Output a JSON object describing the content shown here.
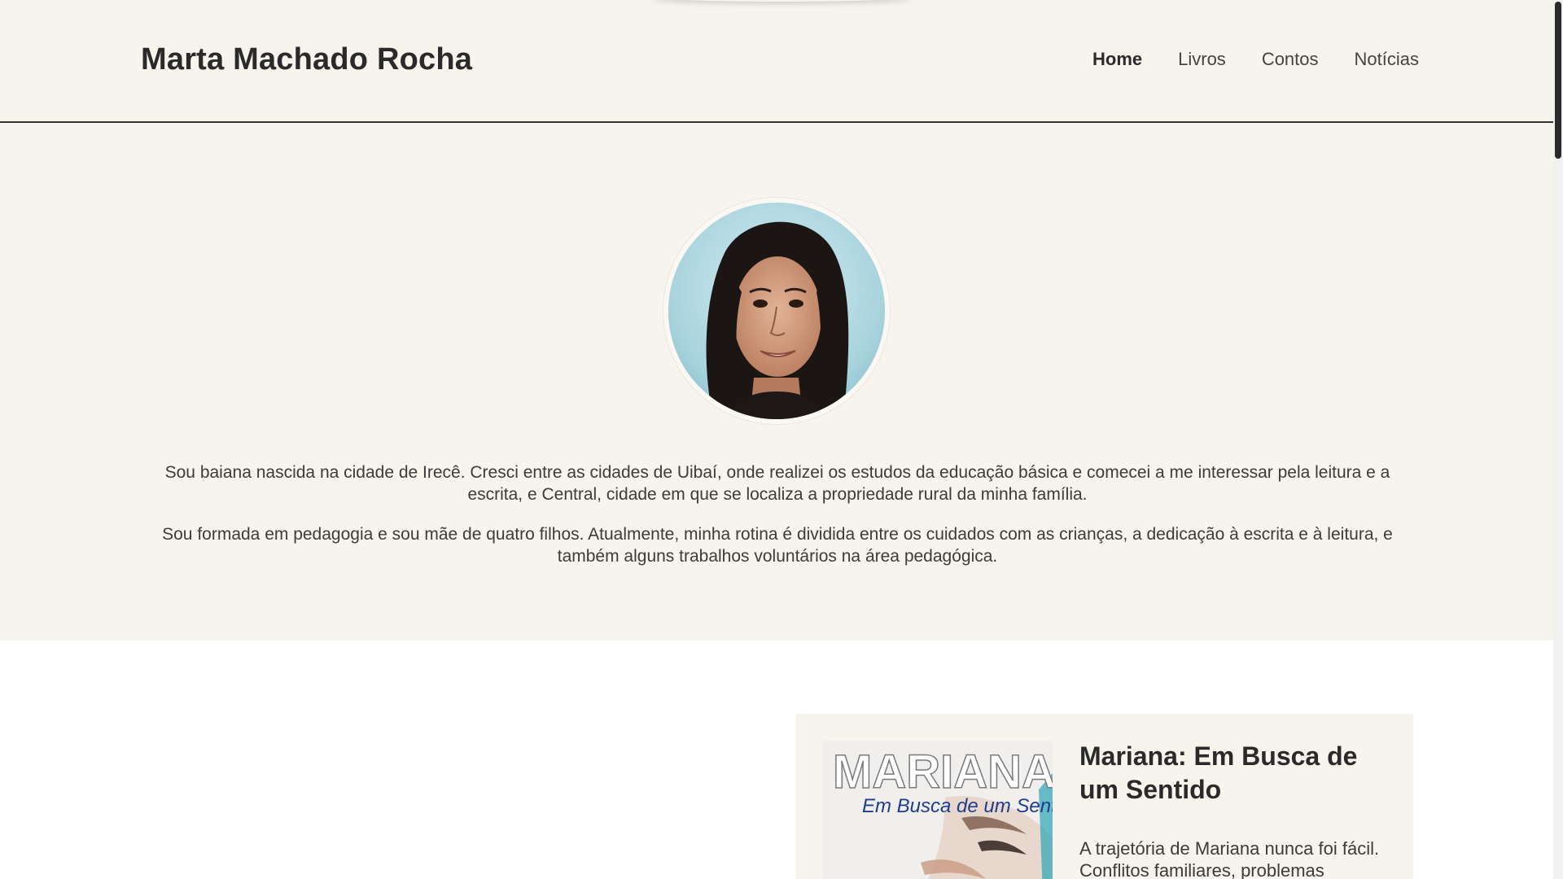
{
  "header": {
    "site_title": "Marta Machado Rocha",
    "nav": [
      {
        "label": "Home",
        "active": true
      },
      {
        "label": "Livros",
        "active": false
      },
      {
        "label": "Contos",
        "active": false
      },
      {
        "label": "Notícias",
        "active": false
      }
    ]
  },
  "about": {
    "paragraphs": [
      "Sou baiana nascida na cidade de Irecê. Cresci entre as cidades de Uibaí, onde realizei os estudos da educação básica e comecei a me interessar pela leitura e a escrita, e Central, cidade em que se localiza a propriedade rural da minha família.",
      "Sou formada em pedagogia e sou mãe de quatro filhos. Atualmente, minha rotina é dividida entre os cuidados com as crianças, a dedicação à escrita e à leitura, e também alguns trabalhos voluntários na área pedagógica."
    ]
  },
  "book": {
    "cover_title": "MARIANA",
    "cover_subtitle": "Em Busca de um Sentido",
    "title": "Mariana: Em Busca de um Sentido",
    "description": "A trajetória de Mariana nunca foi fácil. Conflitos familiares, problemas"
  },
  "colors": {
    "background_cream": "#f7f3ed",
    "text_dark": "#2a2a2a",
    "nav_underline": "#333333",
    "cover_blue": "#1e3d8f"
  }
}
